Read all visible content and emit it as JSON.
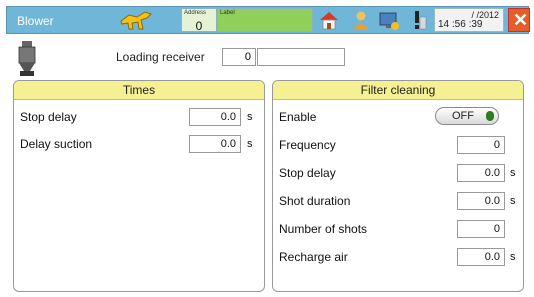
{
  "header": {
    "title": "Blower",
    "address_label": "Address",
    "address_value": "0",
    "label_caption": "Label",
    "date": "/ /2012",
    "time": "14 :56 :39"
  },
  "loading_receiver": {
    "label": "Loading receiver",
    "value": "0",
    "name": ""
  },
  "times": {
    "title": "Times",
    "rows": [
      {
        "label": "Stop delay",
        "value": "0.0",
        "unit": "s"
      },
      {
        "label": "Delay suction",
        "value": "0.0",
        "unit": "s"
      }
    ]
  },
  "filter_cleaning": {
    "title": "Filter cleaning",
    "enable_label": "Enable",
    "enable_state": "OFF",
    "rows": [
      {
        "label": "Frequency",
        "value": "0",
        "unit": ""
      },
      {
        "label": "Stop delay",
        "value": "0.0",
        "unit": "s"
      },
      {
        "label": "Shot duration",
        "value": "0.0",
        "unit": "s"
      },
      {
        "label": "Number of shots",
        "value": "0",
        "unit": ""
      },
      {
        "label": "Recharge air",
        "value": "0.0",
        "unit": "s"
      }
    ]
  },
  "colors": {
    "header_bg": "#6fb6d8",
    "panel_header": "#f5f092",
    "close_button": "#e85c2a",
    "label_box": "#8fcf5a"
  }
}
